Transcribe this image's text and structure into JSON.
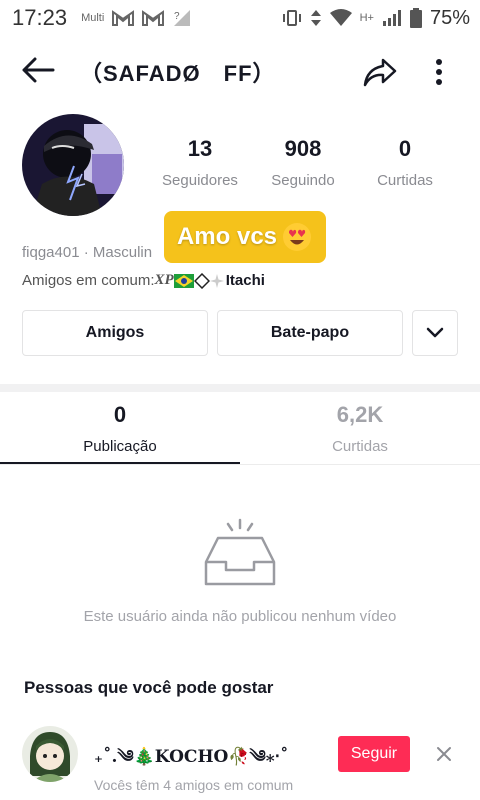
{
  "status_bar": {
    "time": "17:23",
    "carrier_tag": "Multi",
    "network_tag": "H+",
    "battery": "75%"
  },
  "header": {
    "title": "（SAFADØ　FF）",
    "icons": {
      "back": "arrow-left-icon",
      "share": "share-arrow-icon",
      "more": "more-vertical-icon"
    }
  },
  "profile": {
    "stats": [
      {
        "value": "13",
        "label": "Seguidores"
      },
      {
        "value": "908",
        "label": "Seguindo"
      },
      {
        "value": "0",
        "label": "Curtidas"
      }
    ],
    "sticker_text": "Amo vcs",
    "handle": "fiqga401 · Masculin",
    "mutual_prefix": "Amigos em comum:",
    "mutual_name_prefix": "XP",
    "mutual_name": "Itachi"
  },
  "actions": {
    "friends_label": "Amigos",
    "chat_label": "Bate-papo"
  },
  "tabs": [
    {
      "value": "0",
      "label": "Publicação"
    },
    {
      "value": "6,2K",
      "label": "Curtidas"
    }
  ],
  "empty_state": {
    "text": "Este usuário ainda não publicou nenhum vídeo"
  },
  "suggestions": {
    "title": "Pessoas que você pode gostar",
    "item": {
      "name": "₊˚.༄🎄KOCHO🥀༄⁎‧˚",
      "subtitle": "Vocês têm 4 amigos em comum",
      "follow_label": "Seguir"
    }
  },
  "colors": {
    "accent": "#fe2c55",
    "sticker": "#f5c21b",
    "muted_text": "#8a8b91"
  }
}
